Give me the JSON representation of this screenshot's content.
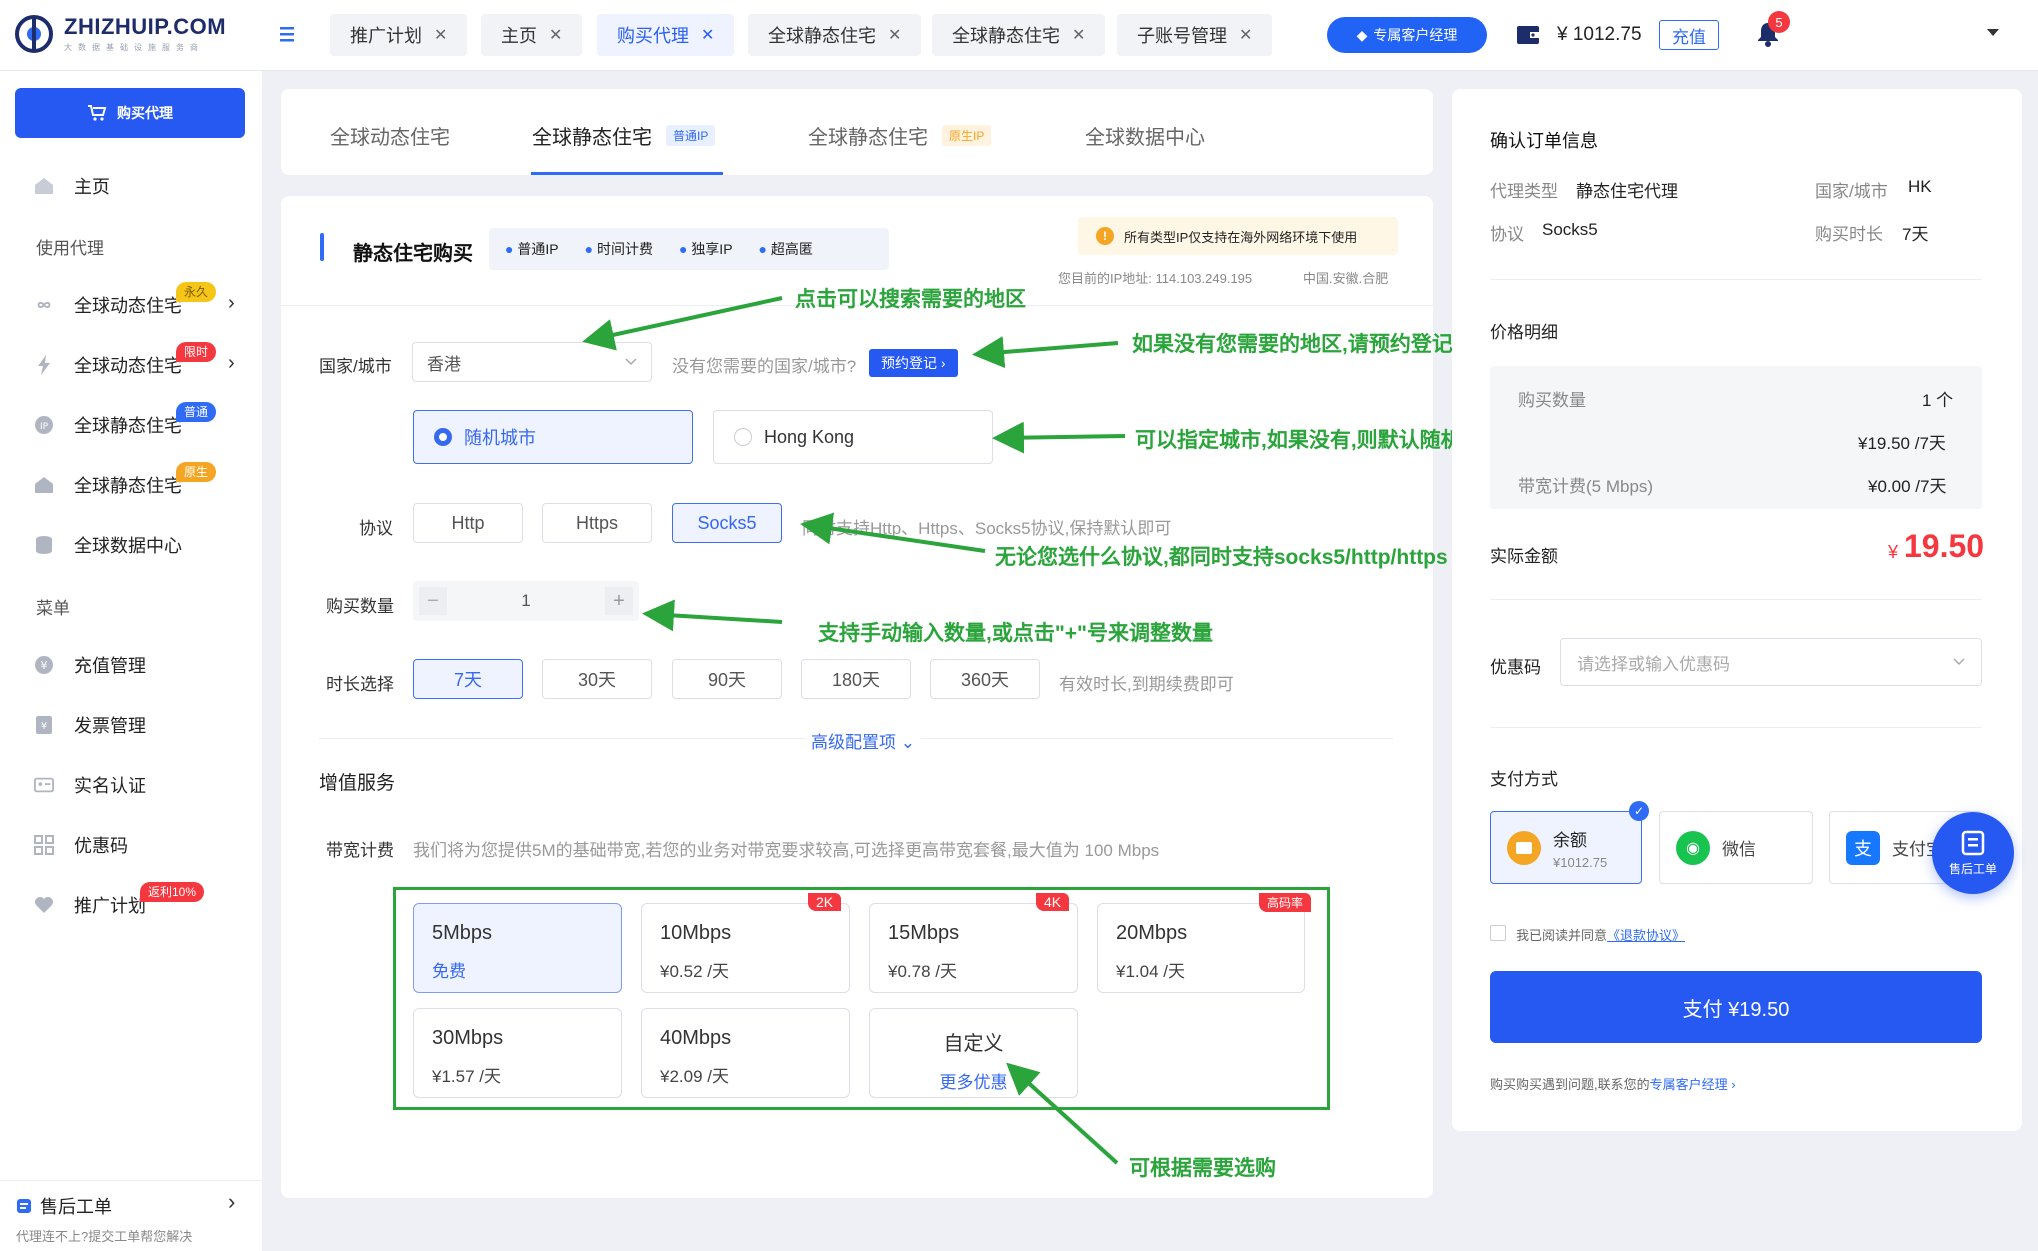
{
  "brand": {
    "name": "ZHIZHUIP.COM",
    "sub": "大数据基础设施服务商"
  },
  "top_tabs": [
    {
      "label": "推广计划"
    },
    {
      "label": "主页"
    },
    {
      "label": "购买代理"
    },
    {
      "label": "全球静态住宅"
    },
    {
      "label": "全球静态住宅"
    },
    {
      "label": "子账号管理"
    }
  ],
  "header": {
    "manager_label": "专属客户经理",
    "balance": "¥ 1012.75",
    "recharge_label": "充值",
    "notif_count": "5"
  },
  "sidebar": {
    "buy_label": "购买代理",
    "home": "主页",
    "group_use": "使用代理",
    "items": [
      {
        "label": "全球动态住宅",
        "badge": "永久",
        "badge_color": "#f5c518"
      },
      {
        "label": "全球动态住宅",
        "badge": "限时",
        "badge_color": "#f5383f"
      },
      {
        "label": "全球静态住宅",
        "badge": "普通",
        "badge_color": "#2f6bf5"
      },
      {
        "label": "全球静态住宅",
        "badge": "原生",
        "badge_color": "#f5a524"
      },
      {
        "label": "全球数据中心",
        "badge": ""
      }
    ],
    "group_menu": "菜单",
    "menu": [
      {
        "label": "充值管理"
      },
      {
        "label": "发票管理"
      },
      {
        "label": "实名认证"
      },
      {
        "label": "优惠码"
      },
      {
        "label": "推广计划",
        "badge": "返利10%"
      }
    ],
    "ticket": {
      "title": "售后工单",
      "desc": "代理连不上?提交工单帮您解决"
    }
  },
  "product_tabs": [
    {
      "label": "全球动态住宅"
    },
    {
      "label": "全球静态住宅",
      "tag": "普通IP"
    },
    {
      "label": "全球静态住宅",
      "tag": "原生IP"
    },
    {
      "label": "全球数据中心"
    }
  ],
  "form": {
    "title": "静态住宅购买",
    "features": [
      "普通IP",
      "时间计费",
      "独享IP",
      "超高匿"
    ],
    "notice": "所有类型IP仅支持在海外网络环境下使用",
    "ip_info": "您目前的IP地址: 114.103.249.195",
    "ip_loc": "中国.安徽.合肥",
    "country_label": "国家/城市",
    "country_value": "香港",
    "country_hint": "没有您需要的国家/城市?",
    "reserve_label": "预约登记 ›",
    "city_random": "随机城市",
    "city_hk": "Hong Kong",
    "protocol_label": "协议",
    "protocols": [
      "Http",
      "Https",
      "Socks5"
    ],
    "protocol_hint": "同时支持Http、Https、Socks5协议,保持默认即可",
    "qty_label": "购买数量",
    "qty_value": "1",
    "dur_label": "时长选择",
    "durations": [
      "7天",
      "30天",
      "90天",
      "180天",
      "360天"
    ],
    "dur_hint": "有效时长,到期续费即可",
    "advanced": "高级配置项",
    "vas_title": "增值服务",
    "bw_label": "带宽计费",
    "bw_desc": "我们将为您提供5M的基础带宽,若您的业务对带宽要求较高,可选择更高带宽套餐,最大值为 100 Mbps",
    "bandwidth": [
      {
        "name": "5Mbps",
        "price": "免费",
        "tag": ""
      },
      {
        "name": "10Mbps",
        "price": "¥0.52 /天",
        "tag": "2K"
      },
      {
        "name": "15Mbps",
        "price": "¥0.78 /天",
        "tag": "4K"
      },
      {
        "name": "20Mbps",
        "price": "¥1.04 /天",
        "tag": "高码率"
      },
      {
        "name": "30Mbps",
        "price": "¥1.57 /天",
        "tag": ""
      },
      {
        "name": "40Mbps",
        "price": "¥2.09 /天",
        "tag": ""
      },
      {
        "name": "自定义",
        "price": "更多优惠",
        "tag": ""
      }
    ]
  },
  "annotations": [
    "点击可以搜索需要的地区",
    "如果没有您需要的地区,请预约登记,上线会第一时间通知您",
    "可以指定城市,如果没有,则默认随机城市",
    "无论您选什么协议,都同时支持socks5/http/https",
    "支持手动输入数量,或点击\"+\"号来调整数量",
    "可根据需要选购"
  ],
  "order": {
    "title": "确认订单信息",
    "type_label": "代理类型",
    "type_value": "静态住宅代理",
    "country_label": "国家/城市",
    "country_value": "HK",
    "protocol_label": "协议",
    "protocol_value": "Socks5",
    "duration_label": "购买时长",
    "duration_value": "7天",
    "price_title": "价格明细",
    "qty_label": "购买数量",
    "qty_value": "1 个",
    "unit_price": "¥19.50 /7天",
    "bw_label": "带宽计费(5 Mbps)",
    "bw_value": "¥0.00 /7天",
    "total_label": "实际金额",
    "total_currency": "¥",
    "total_value": "19.50",
    "coupon_label": "优惠码",
    "coupon_placeholder": "请选择或输入优惠码",
    "pay_title": "支付方式",
    "pay_methods": [
      {
        "label": "余额",
        "sub": "¥1012.75"
      },
      {
        "label": "微信"
      },
      {
        "label": "支付宝"
      }
    ],
    "agree_text": "我已阅读并同意",
    "agree_link": "《退款协议》",
    "pay_button": "支付 ¥19.50",
    "help_text": "购买购买遇到问题,联系您的",
    "help_link": "专属客户经理 ›",
    "float_label": "售后工单"
  }
}
